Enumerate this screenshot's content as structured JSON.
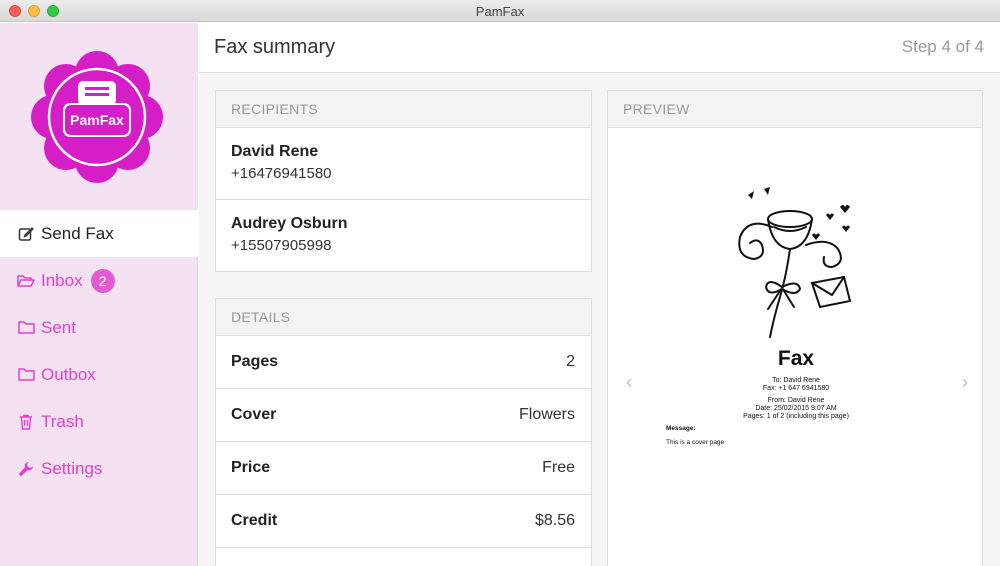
{
  "window": {
    "title": "PamFax"
  },
  "logo": {
    "text": "PamFax",
    "color": "#d61ec6"
  },
  "nav": [
    {
      "label": "Send Fax",
      "icon": "edit-icon",
      "active": true
    },
    {
      "label": "Inbox",
      "icon": "folder-open-icon",
      "badge": "2"
    },
    {
      "label": "Sent",
      "icon": "folder-icon"
    },
    {
      "label": "Outbox",
      "icon": "folder-icon"
    },
    {
      "label": "Trash",
      "icon": "trash-icon"
    },
    {
      "label": "Settings",
      "icon": "wrench-icon"
    }
  ],
  "header": {
    "title": "Fax summary",
    "step": "Step 4 of 4"
  },
  "recipients": {
    "heading": "RECIPIENTS",
    "items": [
      {
        "name": "David Rene",
        "number": "+16476941580"
      },
      {
        "name": "Audrey Osburn",
        "number": "+15507905998"
      }
    ]
  },
  "details": {
    "heading": "DETAILS",
    "rows": [
      {
        "label": "Pages",
        "value": "2"
      },
      {
        "label": "Cover",
        "value": "Flowers"
      },
      {
        "label": "Price",
        "value": "Free"
      },
      {
        "label": "Credit",
        "value": "$8.56"
      }
    ]
  },
  "preview": {
    "heading": "PREVIEW",
    "fax_title": "Fax",
    "to": "To: David Rene",
    "fax": "Fax: +1 647 6941580",
    "from": "From: David Rene",
    "date": "Date: 25/02/2015 9:07 AM",
    "pages": "Pages: 1 of 2 (including this page)",
    "message_label": "Message:",
    "message": "This is a cover page",
    "prev_arrow": "‹",
    "next_arrow": "›"
  },
  "colors": {
    "accent": "#e23fcf",
    "sidebar_bg": "#f4e1f2"
  }
}
